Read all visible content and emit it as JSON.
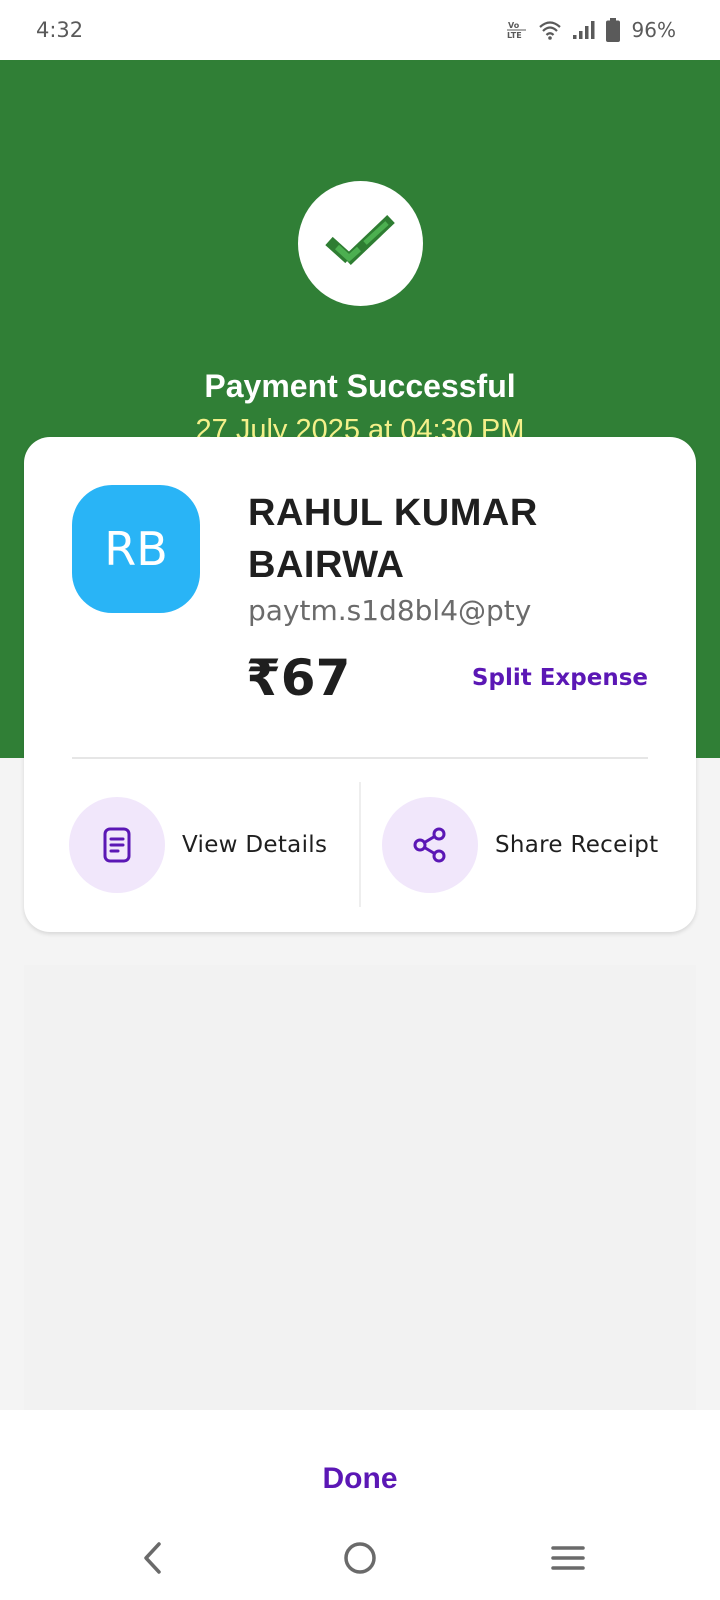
{
  "status_bar": {
    "time": "4:32",
    "battery_percent": "96%",
    "network_label": "VoLTE"
  },
  "header": {
    "title": "Payment Successful",
    "datetime": "27 July 2025 at 04:30 PM",
    "check_icon": "check-icon"
  },
  "payee": {
    "initials": "RB",
    "name": "RAHUL KUMAR BAIRWA",
    "upi_id": "paytm.s1d8bl4@pty",
    "amount": "₹67"
  },
  "actions": {
    "split_label": "Split Expense",
    "view_details_label": "View Details",
    "share_receipt_label": "Share Receipt"
  },
  "footer": {
    "done_label": "Done"
  },
  "colors": {
    "header_green": "#307f36",
    "avatar_blue": "#29b4f6",
    "accent_purple": "#5b17b5",
    "date_yellow": "#f4f08a",
    "icon_bg": "#f1e7fb"
  }
}
